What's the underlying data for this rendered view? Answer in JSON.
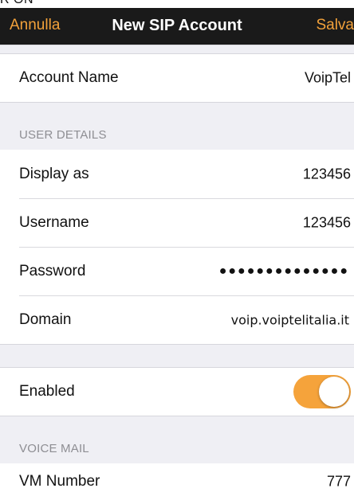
{
  "status_bar": {
    "partial_text": "R ON"
  },
  "nav": {
    "cancel_label": "Annulla",
    "title": "New SIP Account",
    "save_label": "Salva",
    "accent_color": "#f2a13a"
  },
  "account": {
    "label": "Account Name",
    "value": "VoipTel"
  },
  "user_details": {
    "header": "USER DETAILS",
    "display_as": {
      "label": "Display as",
      "value": "123456"
    },
    "username": {
      "label": "Username",
      "value": "123456"
    },
    "password": {
      "label": "Password",
      "value": "●●●●●●●●●●●●●●"
    },
    "domain": {
      "label": "Domain",
      "value": "voip.voiptelitalia.it"
    }
  },
  "enabled": {
    "label": "Enabled",
    "on": true,
    "toggle_color": "#f5a33b"
  },
  "voice_mail": {
    "header": "VOICE MAIL",
    "vm_number": {
      "label": "VM Number",
      "value": "777"
    }
  }
}
